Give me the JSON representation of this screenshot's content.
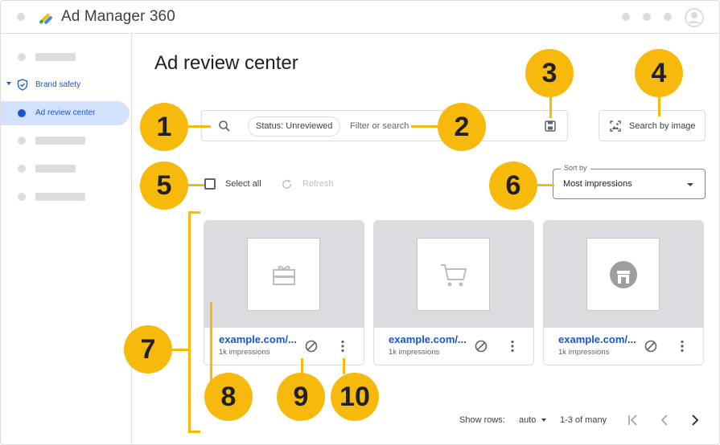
{
  "app": {
    "title": "Ad Manager 360"
  },
  "sidebar": {
    "group_label": "Brand safety",
    "active_label": "Ad review center"
  },
  "page": {
    "title": "Ad review center"
  },
  "search": {
    "chip": "Status: Unreviewed",
    "placeholder": "Filter or search",
    "image_search_label": "Search by image"
  },
  "toolbar": {
    "select_all": "Select all",
    "refresh": "Refresh"
  },
  "sort": {
    "caption": "Sort by",
    "value": "Most impressions"
  },
  "cards": [
    {
      "link": "example.com/...",
      "meta": "1k impressions",
      "thumb_icon": "gift-card-icon"
    },
    {
      "link": "example.com/...",
      "meta": "1k impressions",
      "thumb_icon": "shopping-cart-icon"
    },
    {
      "link": "example.com/...",
      "meta": "1k impressions",
      "thumb_icon": "storefront-icon"
    }
  ],
  "pagination": {
    "rows_label": "Show rows:",
    "rows_value": "auto",
    "range": "1-3 of many"
  },
  "callouts": [
    "1",
    "2",
    "3",
    "4",
    "5",
    "6",
    "7",
    "8",
    "9",
    "10"
  ],
  "colors": {
    "accent": "#1a56c8",
    "callout": "#f7b90b",
    "border": "#dadce0"
  }
}
